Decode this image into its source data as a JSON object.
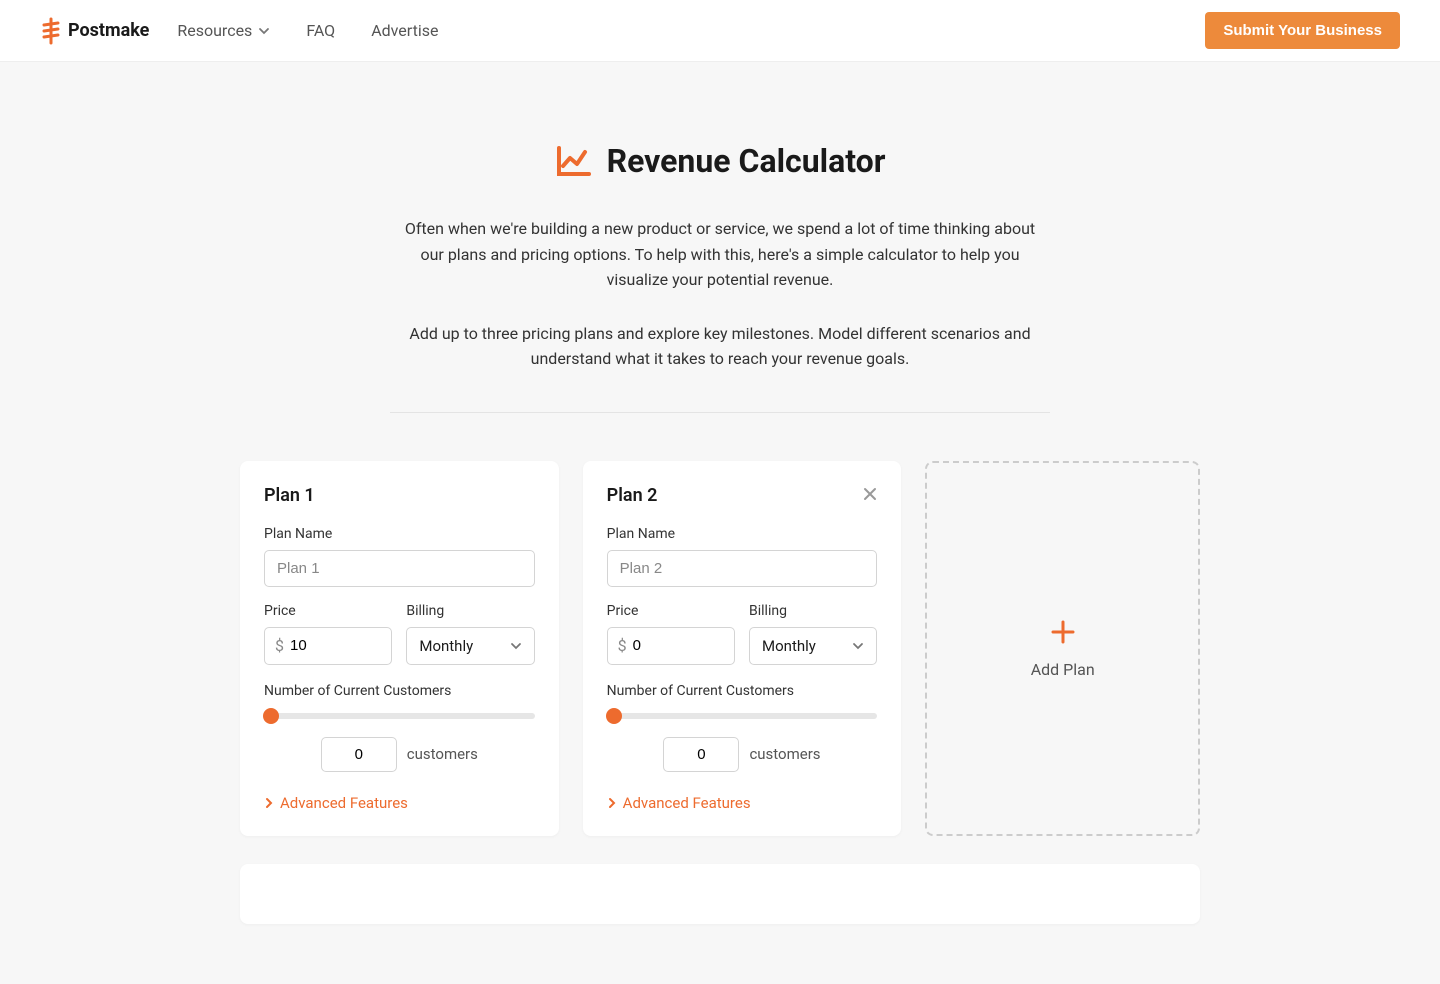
{
  "brand": "Postmake",
  "nav": {
    "resources": "Resources",
    "faq": "FAQ",
    "advertise": "Advertise",
    "submit": "Submit Your Business"
  },
  "page": {
    "title": "Revenue Calculator",
    "desc1": "Often when we're building a new product or service, we spend a lot of time thinking about our plans and pricing options. To help with this, here's a simple calculator to help you visualize your potential revenue.",
    "desc2": "Add up to three pricing plans and explore key milestones. Model different scenarios and understand what it takes to reach your revenue goals."
  },
  "labels": {
    "plan_name": "Plan Name",
    "price": "Price",
    "billing": "Billing",
    "num_customers": "Number of Current Customers",
    "customers_suffix": "customers",
    "advanced": "Advanced Features",
    "add_plan": "Add Plan",
    "currency": "$"
  },
  "plans": [
    {
      "title": "Plan 1",
      "name_placeholder": "Plan 1",
      "price": "10",
      "billing": "Monthly",
      "customers": "0",
      "closable": false
    },
    {
      "title": "Plan 2",
      "name_placeholder": "Plan 2",
      "price": "0",
      "billing": "Monthly",
      "customers": "0",
      "closable": true
    }
  ],
  "colors": {
    "accent": "#ed6b2e",
    "accent_light": "#ed8a3b"
  }
}
